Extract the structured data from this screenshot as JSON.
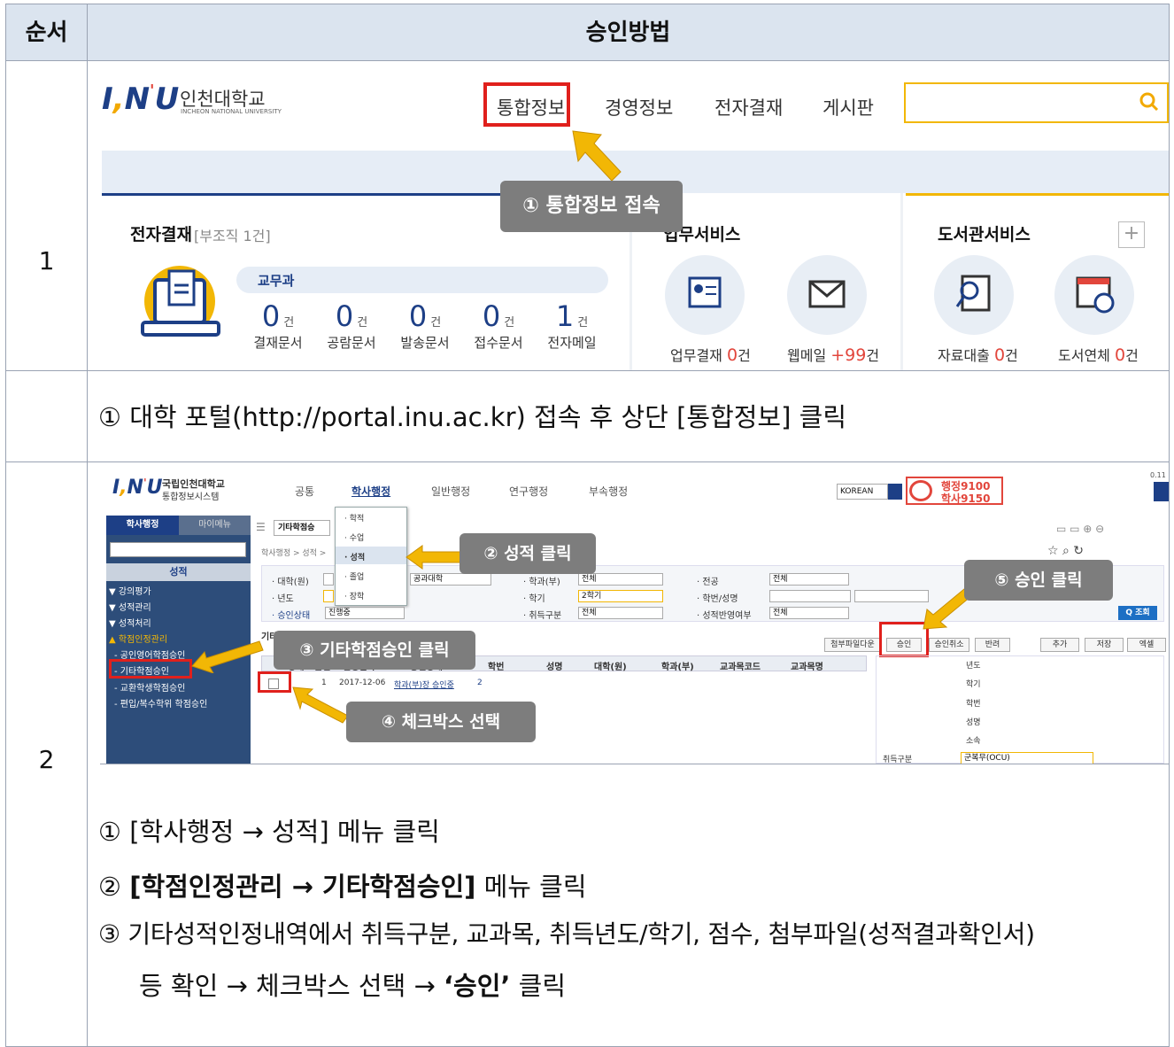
{
  "table": {
    "header_col1": "순서",
    "header_col2": "승인방법"
  },
  "row1": {
    "num": "1",
    "screen": {
      "logo_text": "인천대학교",
      "logo_sub": "INCHEON NATIONAL UNIVERSITY",
      "nav": [
        "통합정보",
        "경영정보",
        "전자결재",
        "게시판"
      ],
      "callout": "① 통합정보 접속",
      "ea_title": "전자결재",
      "ea_org": "[부조직 1건]",
      "dept": "교무과",
      "stats": [
        {
          "n": "0",
          "u": "건",
          "l": "결재문서"
        },
        {
          "n": "0",
          "u": "건",
          "l": "공람문서"
        },
        {
          "n": "0",
          "u": "건",
          "l": "발송문서"
        },
        {
          "n": "0",
          "u": "건",
          "l": "접수문서"
        },
        {
          "n": "1",
          "u": "건",
          "l": "전자메일"
        }
      ],
      "svc_title": "업무서비스",
      "svc_items": [
        {
          "label": "업무결재",
          "value": "0",
          "unit": "건"
        },
        {
          "label": "웹메일",
          "value": "+99",
          "unit": "건"
        }
      ],
      "lib_title": "도서관서비스",
      "lib_items": [
        {
          "label": "자료대출",
          "value": "0",
          "unit": "건"
        },
        {
          "label": "도서연체",
          "value": "0",
          "unit": "건"
        }
      ],
      "plus": "+"
    },
    "caption": "① 대학 포털(http://portal.inu.ac.kr) 접속 후 상단 [통합정보] 클릭"
  },
  "row2": {
    "num": "2",
    "screen": {
      "logo_title": "국립인천대학교",
      "logo_sub": "통합정보시스템",
      "topnav": [
        "공통",
        "학사행정",
        "일반행정",
        "연구행정",
        "부속행정"
      ],
      "lang": "KOREAN",
      "hotline1": "행정9100",
      "hotline2": "학사9150",
      "side_tabs": [
        "학사행정",
        "마이메뉴"
      ],
      "side_section": "성적",
      "side_groups": [
        "▼ 강의평가",
        "▼ 성적관리",
        "▼ 성적처리",
        "▲ 학점인정관리"
      ],
      "side_items": [
        "- 공인영어학점승인",
        "- 기타학점승인",
        "- 교환학생학점승인",
        "- 편입/복수학위 학점승인"
      ],
      "tab_label": "기타학점승",
      "breadcrumb": "학사행정 > 성적 >",
      "dropdown": [
        "· 학적",
        "· 수업",
        "· 성적",
        "· 졸업",
        "· 장학"
      ],
      "filters": {
        "univ_label": "· 대학(원)",
        "univ_val": "공과대학",
        "year_label": "· 년도",
        "status_label": "· 승인상태",
        "status_val": "진행중",
        "dept_label": "· 학과(부)",
        "dept_val": "전체",
        "term_label": "· 학기",
        "term_val": "2학기",
        "type_label": "· 취득구분",
        "type_val": "전체",
        "major_label": "· 전공",
        "major_val": "전체",
        "sid_label": "· 학번/성명",
        "reflect_label": "· 성적반영여부",
        "reflect_val": "전체"
      },
      "search_btn": "Q 조회",
      "section_title": "기타성적인정내역",
      "buttons": [
        "첨부파일다운",
        "승인",
        "승인취소",
        "반려",
        "추가",
        "저장",
        "엑셀"
      ],
      "grid_headers": [
        "상태",
        "순번",
        "신청일자",
        "승인상태",
        "학번",
        "성명",
        "대학(원)",
        "학과(부)",
        "교과목코드",
        "교과목명"
      ],
      "grid_row": {
        "seq": "1",
        "date": "2017-12-06",
        "status": "학과(부)장 승인중",
        "extra": "2"
      },
      "detail_labels": [
        "년도",
        "학기",
        "학번",
        "성명",
        "소속",
        "취득구분"
      ],
      "detail_type_val": "군복무(OCU)",
      "callouts": [
        "② 성적 클릭",
        "⑤ 승인 클릭",
        "③ 기타학점승인 클릭",
        "④ 체크박스 선택"
      ],
      "corner": "0.11"
    },
    "lines": [
      {
        "n": "①",
        "pre": "[학사행정 → 성적] 메뉴 클릭",
        "bold": "",
        "post": ""
      },
      {
        "n": "②",
        "pre": "",
        "bold": "[학점인정관리 → 기타학점승인]",
        "post": " 메뉴 클릭"
      },
      {
        "n": "③",
        "pre": "기타성적인정내역에서 취득구분, 교과목, 취득년도/학기, 점수, 첨부파일(성적결과확인서)",
        "bold": "",
        "post": ""
      }
    ],
    "line4": {
      "pre": "등 확인 → 체크박스 선택 → ",
      "bold": "‘승인’",
      "post": " 클릭"
    }
  },
  "colors": {
    "header_bg": "#dbe4ef",
    "border": "#9aa3b3",
    "red": "#e0201c",
    "callout": "#7d7d7d",
    "arrow": "#f2b705",
    "navy": "#1d3f86"
  }
}
